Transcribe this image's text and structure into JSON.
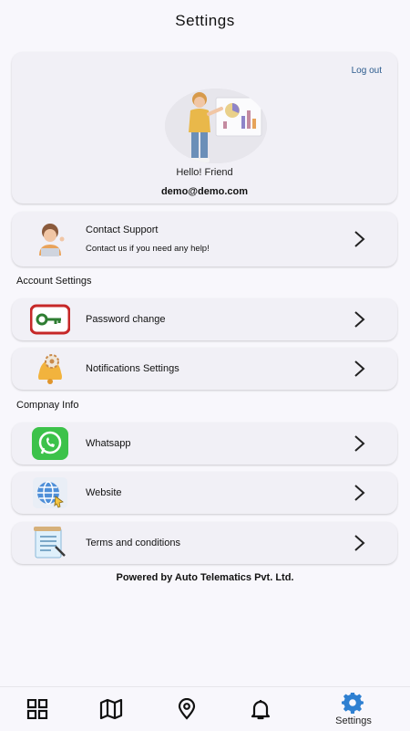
{
  "header": {
    "title": "Settings"
  },
  "profile": {
    "logout_label": "Log out",
    "greeting": "Hello! Friend",
    "email": "demo@demo.com"
  },
  "support": {
    "label": "Contact Support",
    "sublabel": "Contact us if you need any help!",
    "icon": "support-person-icon"
  },
  "account_section": {
    "title": "Account Settings",
    "items": [
      {
        "label": "Password change",
        "icon": "key-icon"
      },
      {
        "label": "Notifications Settings",
        "icon": "bell-gear-icon"
      }
    ]
  },
  "company_section": {
    "title": "Compnay Info",
    "items": [
      {
        "label": "Whatsapp",
        "icon": "whatsapp-icon"
      },
      {
        "label": "Website",
        "icon": "globe-icon"
      },
      {
        "label": "Terms and conditions",
        "icon": "document-icon"
      }
    ]
  },
  "footer": {
    "powered_by": "Powered by Auto Telematics Pvt. Ltd."
  },
  "bottom_nav": {
    "items": [
      {
        "name": "dashboard",
        "icon": "grid-icon"
      },
      {
        "name": "map",
        "icon": "map-icon"
      },
      {
        "name": "location",
        "icon": "location-pin-icon"
      },
      {
        "name": "notifications",
        "icon": "bell-icon"
      },
      {
        "name": "settings",
        "icon": "gear-icon",
        "label": "Settings",
        "active": true
      }
    ],
    "active_color": "#2f80d1"
  }
}
